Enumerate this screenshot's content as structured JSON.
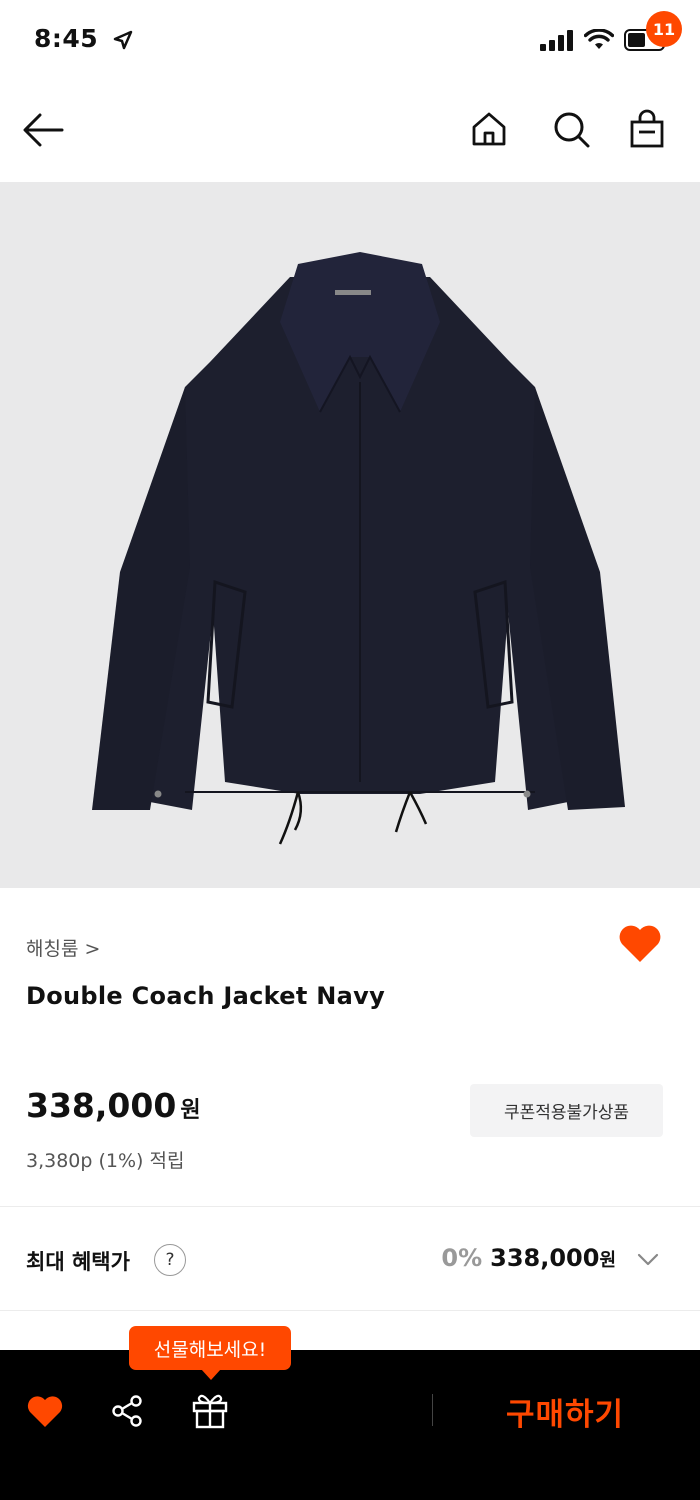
{
  "status_bar": {
    "time": "8:45"
  },
  "nav": {
    "cart_count": "11"
  },
  "product": {
    "brand": "해칭룸 >",
    "name": "Double Coach Jacket Navy",
    "price": "338,000",
    "price_unit": "원",
    "points": "3,380p (1%) 적립",
    "coupon_badge": "쿠폰적용불가상품",
    "wishlisted": true,
    "image_description": "navy coach jacket"
  },
  "benefit": {
    "label": "최대 혜택가",
    "help": "?",
    "discount_pct": "0%",
    "price": "338,000",
    "price_unit": "원"
  },
  "tooltip": {
    "text": "선물해보세요!"
  },
  "bottom_bar": {
    "buy_label": "구매하기"
  },
  "colors": {
    "accent": "#ff4800",
    "image_bg": "#e9e9ea",
    "jacket": "#1d1f2e"
  }
}
